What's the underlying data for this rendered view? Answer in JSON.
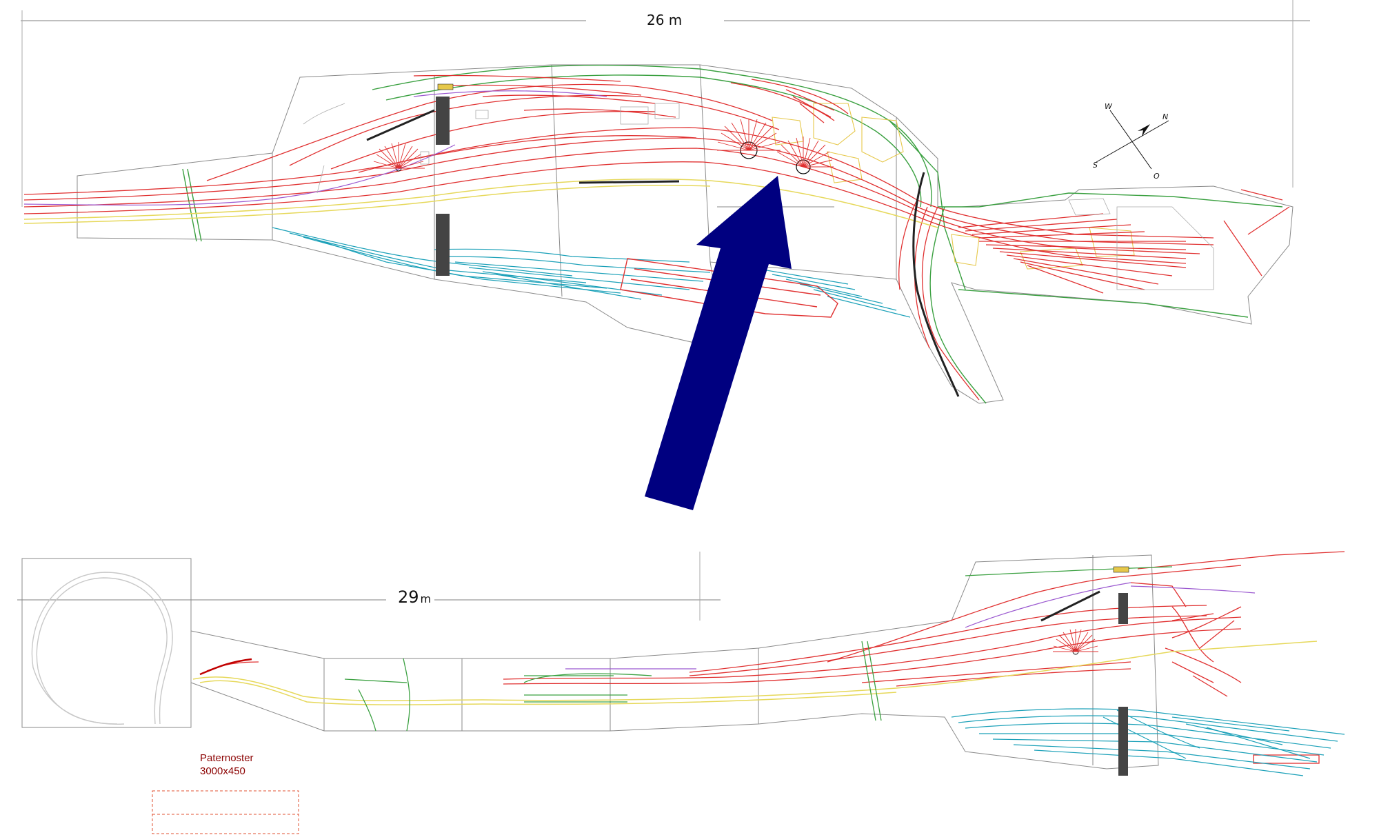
{
  "dimensions": {
    "top_length": "26 m",
    "bottom_value": "29",
    "bottom_unit": "m"
  },
  "compass": {
    "north": "N",
    "south": "S",
    "west": "W",
    "east": "O"
  },
  "paternoster": {
    "title": "Paternoster",
    "size": "3000x450"
  },
  "colors": {
    "main_tracks": "#e03030",
    "yard_tracks": "#1aa0b8",
    "through_tracks": "#e6d85a",
    "aux_tracks": "#9b59d0",
    "outline": "#888888",
    "green_lines": "#3aa040",
    "arrow": "#000080",
    "text_dark_red": "#8b0000"
  }
}
